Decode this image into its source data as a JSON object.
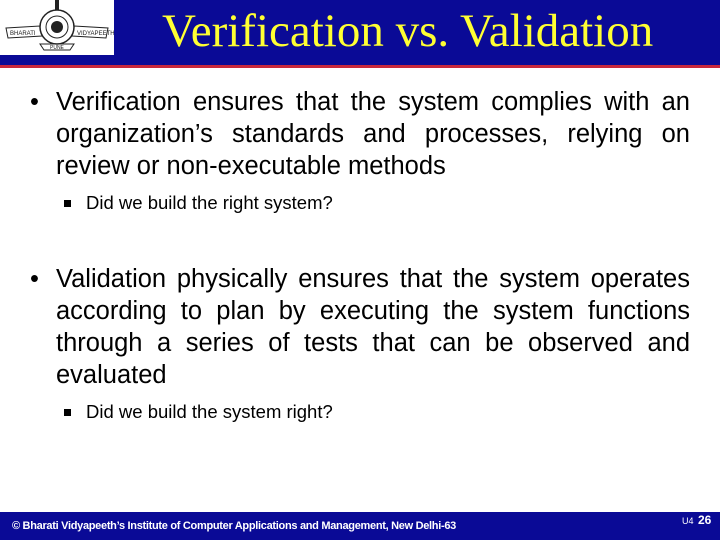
{
  "header": {
    "title": "Verification vs. Validation",
    "logo": {
      "left_text": "BHARATI",
      "right_text": "VIDYAPEETH",
      "bottom_text": "PUNE"
    }
  },
  "bullets": [
    {
      "text": "Verification ensures that the system complies with an organization’s standards and processes, relying on review or non-executable methods",
      "sub": "Did we build the right system?"
    },
    {
      "text": "Validation physically ensures that the system operates according to plan by executing the system functions through a series of tests that can be observed and evaluated",
      "sub": "Did we build the system right?"
    }
  ],
  "footer": {
    "copyright": "© Bharati Vidyapeeth’s Institute of Computer Applications and Management, New Delhi-63",
    "unit": "U4",
    "page": "26"
  },
  "colors": {
    "banner": "#0a0a96",
    "title": "#ffff33",
    "rule": "#c8283c"
  }
}
